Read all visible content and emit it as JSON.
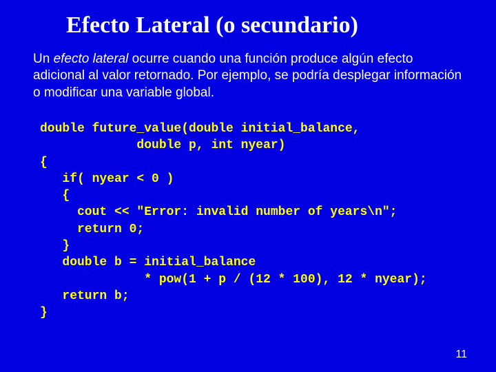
{
  "title": "Efecto Lateral (o secundario)",
  "paragraph": {
    "pre": "Un ",
    "em": "efecto lateral",
    "post": " ocurre cuando una función produce algún efecto adicional al valor retornado. Por ejemplo, se podría desplegar información o modificar una variable global."
  },
  "code": "double future_value(double initial_balance,\n             double p, int nyear)\n{\n   if( nyear < 0 )\n   {\n     cout << \"Error: invalid number of years\\n\";\n     return 0;\n   }\n   double b = initial_balance\n              * pow(1 + p / (12 * 100), 12 * nyear);\n   return b;\n}",
  "page_number": "11"
}
